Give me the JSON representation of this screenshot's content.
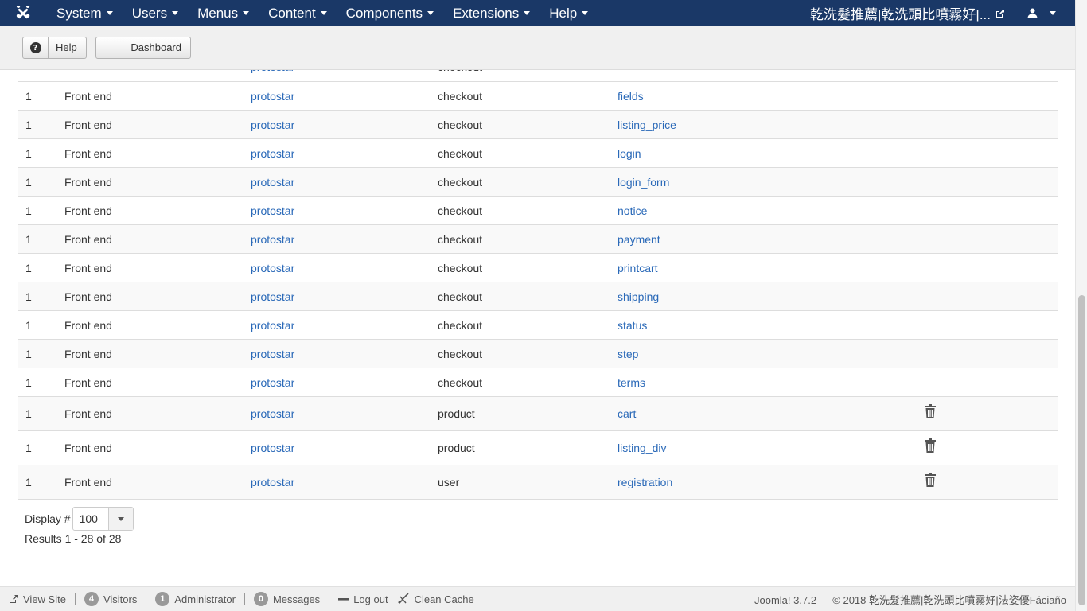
{
  "navbar": {
    "logo": "joomla-logo",
    "menu": [
      "System",
      "Users",
      "Menus",
      "Content",
      "Components",
      "Extensions",
      "Help"
    ],
    "site_name": "乾洗髮推薦|乾洗頭比噴霧好|...",
    "user_icon": "user-icon"
  },
  "toolbar": {
    "help_label": "Help",
    "dashboard_label": "Dashboard"
  },
  "table": {
    "rows": [
      {
        "id": "",
        "client": "",
        "template": "protostar",
        "group": "checkout",
        "name": ""
      },
      {
        "id": "1",
        "client": "Front end",
        "template": "protostar",
        "group": "checkout",
        "name": "fields"
      },
      {
        "id": "1",
        "client": "Front end",
        "template": "protostar",
        "group": "checkout",
        "name": "listing_price"
      },
      {
        "id": "1",
        "client": "Front end",
        "template": "protostar",
        "group": "checkout",
        "name": "login"
      },
      {
        "id": "1",
        "client": "Front end",
        "template": "protostar",
        "group": "checkout",
        "name": "login_form"
      },
      {
        "id": "1",
        "client": "Front end",
        "template": "protostar",
        "group": "checkout",
        "name": "notice"
      },
      {
        "id": "1",
        "client": "Front end",
        "template": "protostar",
        "group": "checkout",
        "name": "payment"
      },
      {
        "id": "1",
        "client": "Front end",
        "template": "protostar",
        "group": "checkout",
        "name": "printcart"
      },
      {
        "id": "1",
        "client": "Front end",
        "template": "protostar",
        "group": "checkout",
        "name": "shipping"
      },
      {
        "id": "1",
        "client": "Front end",
        "template": "protostar",
        "group": "checkout",
        "name": "status"
      },
      {
        "id": "1",
        "client": "Front end",
        "template": "protostar",
        "group": "checkout",
        "name": "step"
      },
      {
        "id": "1",
        "client": "Front end",
        "template": "protostar",
        "group": "checkout",
        "name": "terms"
      },
      {
        "id": "1",
        "client": "Front end",
        "template": "protostar",
        "group": "product",
        "name": "cart"
      },
      {
        "id": "1",
        "client": "Front end",
        "template": "protostar",
        "group": "product",
        "name": "listing_div"
      },
      {
        "id": "1",
        "client": "Front end",
        "template": "protostar",
        "group": "user",
        "name": "registration"
      }
    ]
  },
  "pagination": {
    "display_label": "Display #",
    "limit": "100",
    "results": "Results 1 - 28 of 28"
  },
  "statusbar": {
    "view_site": "View Site",
    "visitors_count": "4",
    "visitors_label": "Visitors",
    "admin_count": "1",
    "admin_label": "Administrator",
    "messages_count": "0",
    "messages_label": "Messages",
    "logout": "Log out",
    "clean_cache": "Clean Cache",
    "copyright": "Joomla! 3.7.2  —  © 2018 乾洗髮推薦|乾洗頭比噴霧好|法姿優Fáciaño"
  },
  "colors": {
    "navbar": "#1a3867",
    "link": "#2a69b8"
  }
}
